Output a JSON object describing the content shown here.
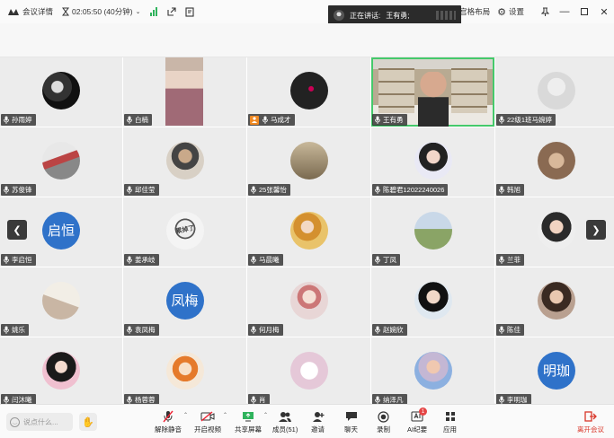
{
  "titlebar": {
    "meeting_info": "会议详情",
    "timer": "02:05:50 (40分钟)",
    "layout": "宫格布局",
    "settings": "设置"
  },
  "speaking": {
    "label": "正在讲话:",
    "name": "王有勇;"
  },
  "tiles": [
    {
      "name": "孙雨婷",
      "style": "c1",
      "kind": "avatar"
    },
    {
      "name": "白楠",
      "style": "video-woman",
      "kind": "video"
    },
    {
      "name": "马成才",
      "style": "c2",
      "kind": "avatar",
      "host": true
    },
    {
      "name": "王有勇",
      "style": "video-man",
      "kind": "video",
      "active": true
    },
    {
      "name": "22级1班马婉婷",
      "style": "c3",
      "kind": "avatar"
    },
    {
      "name": "苏俊锋",
      "style": "c4",
      "kind": "avatar"
    },
    {
      "name": "邱佳莹",
      "style": "c5",
      "kind": "avatar"
    },
    {
      "name": "25张馨怡",
      "style": "c6",
      "kind": "avatar"
    },
    {
      "name": "陈碧君12022240026",
      "style": "c7",
      "kind": "avatar"
    },
    {
      "name": "韩旭",
      "style": "c8",
      "kind": "avatar"
    },
    {
      "name": "李启恒",
      "avatar_text": "启恒",
      "kind": "text"
    },
    {
      "name": "姜承岐",
      "style": "c20",
      "kind": "avatar",
      "stamp": "累掉了"
    },
    {
      "name": "马晨曦",
      "style": "c9",
      "kind": "avatar"
    },
    {
      "name": "丁凤",
      "style": "c10",
      "kind": "avatar"
    },
    {
      "name": "兰菲",
      "style": "c11",
      "kind": "avatar"
    },
    {
      "name": "姚乐",
      "style": "c12",
      "kind": "avatar"
    },
    {
      "name": "袁凤梅",
      "avatar_text": "凤梅",
      "kind": "text"
    },
    {
      "name": "何月梅",
      "style": "c13",
      "kind": "avatar"
    },
    {
      "name": "赵婉欣",
      "style": "c14",
      "kind": "avatar"
    },
    {
      "name": "陈佳",
      "style": "c15",
      "kind": "avatar"
    },
    {
      "name": "闫沐曦",
      "style": "c16",
      "kind": "avatar"
    },
    {
      "name": "杨蓉蓉",
      "style": "c17",
      "kind": "avatar"
    },
    {
      "name": "肖",
      "style": "c18",
      "kind": "avatar"
    },
    {
      "name": "纳泽凡",
      "style": "c19",
      "kind": "avatar"
    },
    {
      "name": "李明珈",
      "avatar_text": "明珈",
      "kind": "text"
    }
  ],
  "toolbar": {
    "chat_placeholder": "说点什么...",
    "unmute": "解除静音",
    "start_video": "开启视频",
    "share": "共享屏幕",
    "members": "成员(51)",
    "invite": "邀请",
    "chat": "聊天",
    "record": "录制",
    "ai_notes": "AI纪要",
    "ai_badge": "1",
    "apps": "应用",
    "leave": "离开会议"
  },
  "colors": {
    "active_border": "#45c96b",
    "avatar_blue": "#2f72c9",
    "leave_red": "#d9372a",
    "host_orange": "#f08a24"
  }
}
